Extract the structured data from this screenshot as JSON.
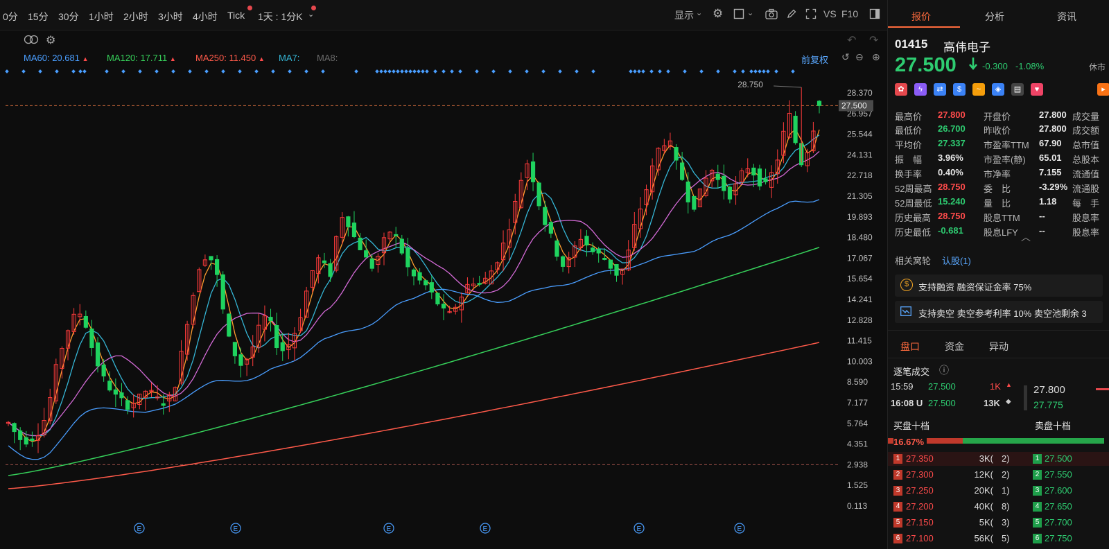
{
  "toolbar": {
    "timeframes": [
      "0分",
      "15分",
      "30分",
      "1小时",
      "2小时",
      "3小时",
      "4小时",
      "Tick",
      "1天 : 1分K"
    ],
    "display_label": "显示",
    "vs_label": "VS",
    "f10_label": "F10"
  },
  "ma_legend": [
    {
      "label": "MA60:",
      "value": "20.681",
      "arrow": "▲",
      "color": "#4a9eff"
    },
    {
      "label": "MA120:",
      "value": "17.711",
      "arrow": "▲",
      "color": "#36d05a"
    },
    {
      "label": "MA250:",
      "value": "11.450",
      "arrow": "▲",
      "color": "#ff5a4a"
    },
    {
      "label": "MA7:",
      "value": "",
      "arrow": "",
      "color": "#35b6d6"
    },
    {
      "label": "MA8:",
      "value": "",
      "arrow": "",
      "color": "#6a6a6a"
    }
  ],
  "adjust_label": "前复权",
  "price_axis": [
    "28.370",
    "26.957",
    "25.544",
    "24.131",
    "22.718",
    "21.305",
    "19.893",
    "18.480",
    "17.067",
    "15.654",
    "14.241",
    "12.828",
    "11.415",
    "10.003",
    "8.590",
    "7.177",
    "5.764",
    "4.351",
    "2.938",
    "1.525",
    "0.113"
  ],
  "current_price_tag": "27.500",
  "high_annotation": "28.750",
  "colors": {
    "up": "#ff3b3b",
    "down": "#1fd35f",
    "ma5": "#ff9d2e",
    "ma10": "#35b6d6",
    "ma20": "#d36ad6",
    "ma60": "#4a9eff",
    "ma120": "#36d05a",
    "ma250": "#ff5a4a"
  },
  "panel": {
    "tabs": [
      "报价",
      "分析",
      "资讯"
    ],
    "code": "01415",
    "name": "高伟电子",
    "price": "27.500",
    "change": "-0.300",
    "change_pct": "-1.08%",
    "status": "休市",
    "stats": [
      {
        "l1": "最高价",
        "v1": "27.800",
        "c1": "red",
        "l2": "开盘价",
        "v2": "27.800",
        "c2": "white",
        "l3": "成交量"
      },
      {
        "l1": "最低价",
        "v1": "26.700",
        "c1": "green",
        "l2": "昨收价",
        "v2": "27.800",
        "c2": "white",
        "l3": "成交额"
      },
      {
        "l1": "平均价",
        "v1": "27.337",
        "c1": "green",
        "l2": "市盈率TTM",
        "v2": "67.90",
        "c2": "white",
        "l3": "总市值"
      },
      {
        "l1": "振　幅",
        "v1": "3.96%",
        "c1": "white",
        "l2": "市盈率(静)",
        "v2": "65.01",
        "c2": "white",
        "l3": "总股本"
      },
      {
        "l1": "换手率",
        "v1": "0.40%",
        "c1": "white",
        "l2": "市净率",
        "v2": "7.155",
        "c2": "white",
        "l3": "流通值"
      },
      {
        "l1": "52周最高",
        "v1": "28.750",
        "c1": "red",
        "l2": "委　比",
        "v2": "-3.29%",
        "c2": "white",
        "l3": "流通股"
      },
      {
        "l1": "52周最低",
        "v1": "15.240",
        "c1": "green",
        "l2": "量　比",
        "v2": "1.18",
        "c2": "white",
        "l3": "每　手"
      },
      {
        "l1": "历史最高",
        "v1": "28.750",
        "c1": "red",
        "l2": "股息TTM",
        "v2": "--",
        "c2": "white",
        "l3": "股息率"
      },
      {
        "l1": "历史最低",
        "v1": "-0.681",
        "c1": "green",
        "l2": "股息LFY",
        "v2": "--",
        "c2": "white",
        "l3": "股息率"
      }
    ],
    "related_label": "相关窝轮",
    "related_link": "认股(1)",
    "margin_text": "支持融资 融资保证金率 75%",
    "short_text": "支持卖空 卖空参考利率 10% 卖空池剩余 3",
    "book_tabs": [
      "盘口",
      "资金",
      "异动"
    ],
    "ticks_title": "逐笔成交",
    "ticks": [
      {
        "time": "15:59",
        "price": "27.500",
        "vol": "1K",
        "arrow": "▲"
      },
      {
        "time": "16:08 U",
        "price": "27.500",
        "vol": "13K",
        "arrow": "◆"
      }
    ],
    "quote_hi": "27.800",
    "quote_lo": "27.775",
    "bid_title": "买盘十档",
    "ask_title": "卖盘十档",
    "bid_ratio": "16.67%",
    "book": [
      {
        "n": "1",
        "bid": "27.350",
        "vol": "3K(",
        "cnt": "2)",
        "ask": "27.500"
      },
      {
        "n": "2",
        "bid": "27.300",
        "vol": "12K(",
        "cnt": "2)",
        "ask": "27.550"
      },
      {
        "n": "3",
        "bid": "27.250",
        "vol": "20K(",
        "cnt": "1)",
        "ask": "27.600"
      },
      {
        "n": "4",
        "bid": "27.200",
        "vol": "40K(",
        "cnt": "8)",
        "ask": "27.650"
      },
      {
        "n": "5",
        "bid": "27.150",
        "vol": "5K(",
        "cnt": "3)",
        "ask": "27.700"
      },
      {
        "n": "6",
        "bid": "27.100",
        "vol": "56K(",
        "cnt": "5)",
        "ask": "27.750"
      }
    ]
  },
  "chart_data": {
    "type": "candlestick",
    "title": "",
    "ylim": [
      0.113,
      28.75
    ],
    "y_ticks": [
      28.37,
      26.957,
      25.544,
      24.131,
      22.718,
      21.305,
      19.893,
      18.48,
      17.067,
      15.654,
      14.241,
      12.828,
      11.415,
      10.003,
      8.59,
      7.177,
      5.764,
      4.351,
      2.938,
      1.525,
      0.113
    ],
    "last_price": 27.5,
    "reference_line": 2.938,
    "high": 28.75,
    "price_path": [
      5.8,
      5.2,
      4.7,
      4.6,
      4.8,
      5.2,
      6.0,
      7.5,
      9.5,
      11.0,
      12.2,
      13.0,
      13.3,
      12.5,
      11.0,
      9.8,
      8.8,
      8.2,
      7.6,
      7.3,
      7.0,
      7.2,
      7.5,
      8.0,
      7.8,
      7.4,
      7.2,
      7.5,
      8.5,
      10.5,
      12.8,
      14.6,
      16.5,
      17.2,
      17.0,
      15.8,
      13.5,
      11.5,
      10.5,
      9.8,
      10.2,
      11.0,
      12.2,
      13.0,
      12.5,
      11.2,
      10.8,
      11.2,
      12.0,
      13.2,
      14.8,
      16.2,
      17.0,
      16.5,
      16.0,
      18.5,
      20.0,
      19.5,
      18.5,
      17.8,
      17.0,
      16.5,
      17.2,
      18.2,
      18.9,
      18.5,
      17.5,
      16.4,
      15.8,
      15.5,
      15.2,
      14.6,
      14.0,
      13.4,
      13.2,
      13.8,
      14.5,
      15.2,
      15.5,
      15.3,
      15.6,
      16.2,
      17.0,
      18.0,
      19.3,
      20.8,
      22.5,
      23.6,
      22.5,
      20.8,
      19.5,
      18.5,
      17.4,
      16.6,
      16.9,
      17.8,
      18.5,
      18.0,
      17.5,
      17.3,
      17.0,
      16.5,
      16.0,
      16.3,
      17.5,
      19.2,
      20.5,
      21.8,
      23.2,
      24.5,
      25.0,
      24.8,
      23.5,
      22.5,
      21.2,
      20.7,
      21.5,
      22.5,
      23.1,
      22.4,
      21.8,
      21.4,
      22.0,
      22.8,
      23.3,
      22.9,
      22.3,
      22.0,
      22.8,
      23.9,
      25.6,
      26.8,
      25.0,
      23.6,
      24.5,
      26.0,
      27.5
    ]
  }
}
